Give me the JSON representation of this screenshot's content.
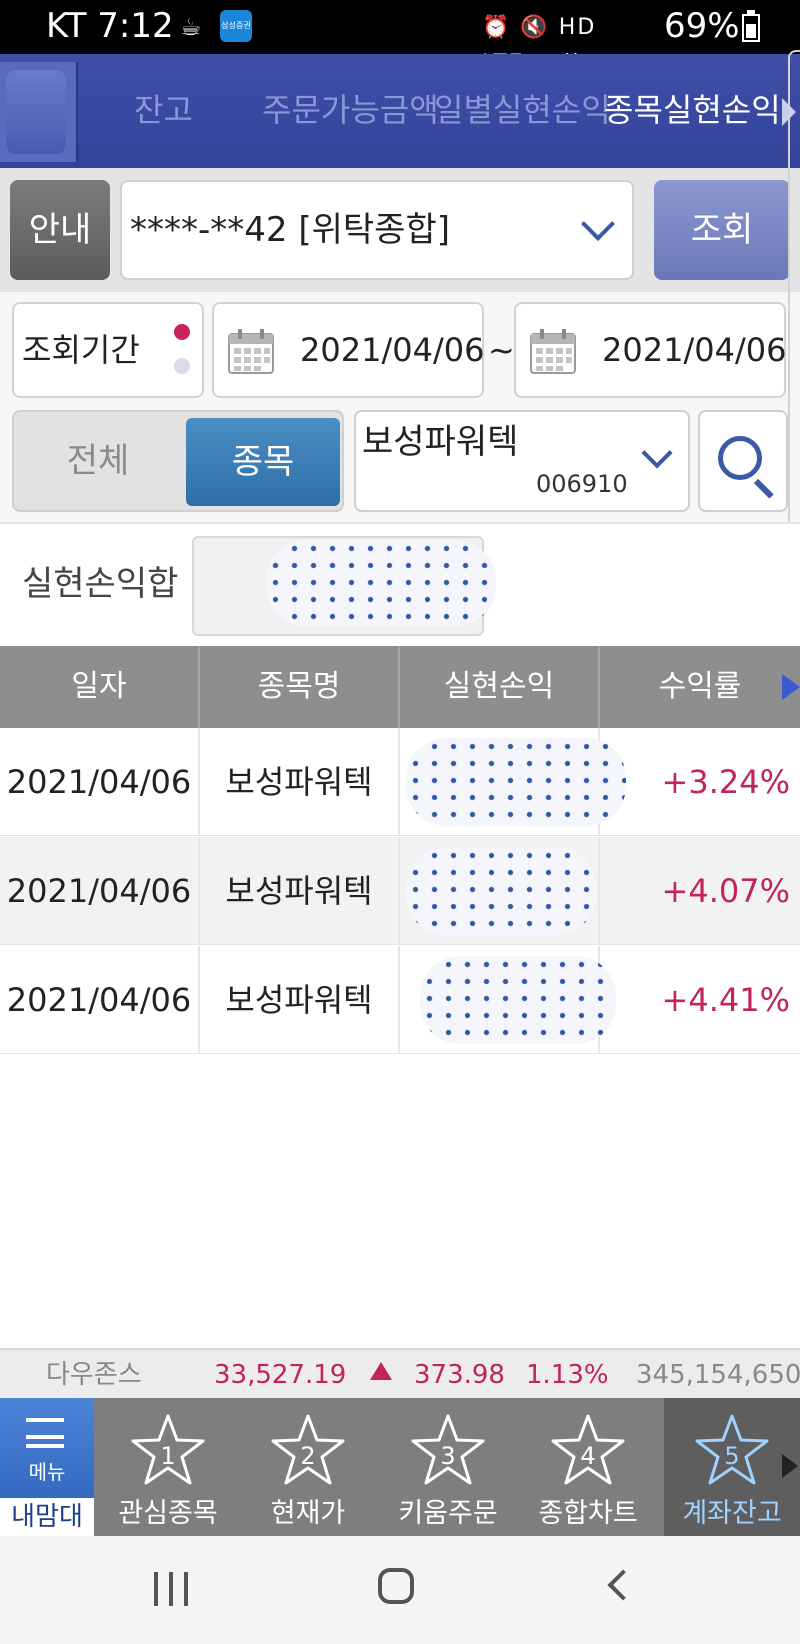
{
  "status_bar": {
    "carrier_time": "KT 7:12",
    "app_icon_label": "삼성증권",
    "battery": "69%",
    "icons": "⏰ 🔇 HD LTE⁺ .ıll"
  },
  "tabs": [
    {
      "label": "잔고"
    },
    {
      "label": "주문가능금액"
    },
    {
      "label": "일별실현손익"
    },
    {
      "label": "종목실현손익",
      "active": true
    }
  ],
  "account": {
    "guide_label": "안내",
    "value": "****-**42 [위탁종합]",
    "query_label": "조회"
  },
  "period": {
    "label": "조회기간",
    "start": "2021/04/06",
    "separator": "~",
    "end": "2021/04/06"
  },
  "filter": {
    "all_label": "전체",
    "stock_label": "종목",
    "selected": "종목",
    "stock_name": "보성파워텍",
    "stock_code": "006910"
  },
  "summary": {
    "label": "실현손익합"
  },
  "table": {
    "columns": [
      "일자",
      "종목명",
      "실현손익",
      "수익률"
    ],
    "rows": [
      {
        "date": "2021/04/06",
        "name": "보성파워텍",
        "rate": "+3.24%"
      },
      {
        "date": "2021/04/06",
        "name": "보성파워텍",
        "rate": "+4.07%"
      },
      {
        "date": "2021/04/06",
        "name": "보성파워텍",
        "rate": "+4.41%"
      }
    ]
  },
  "ticker": {
    "index_name": "다우존스",
    "value": "33,527.19",
    "change": "373.98",
    "percent": "1.13%",
    "volume": "345,154,650"
  },
  "bottom_nav": {
    "menu_label": "메뉴",
    "menu_sub": "내맘대로",
    "items": [
      {
        "num": "1",
        "label": "관심종목"
      },
      {
        "num": "2",
        "label": "현재가"
      },
      {
        "num": "3",
        "label": "키움주문"
      },
      {
        "num": "4",
        "label": "종합차트"
      },
      {
        "num": "5",
        "label": "계좌잔고",
        "active": true
      }
    ]
  },
  "colors": {
    "tab_bar": "#3f4fa7",
    "positive": "#c0245a",
    "active_segment": "#2e6fa7",
    "header_gray": "#8e8e8e"
  }
}
